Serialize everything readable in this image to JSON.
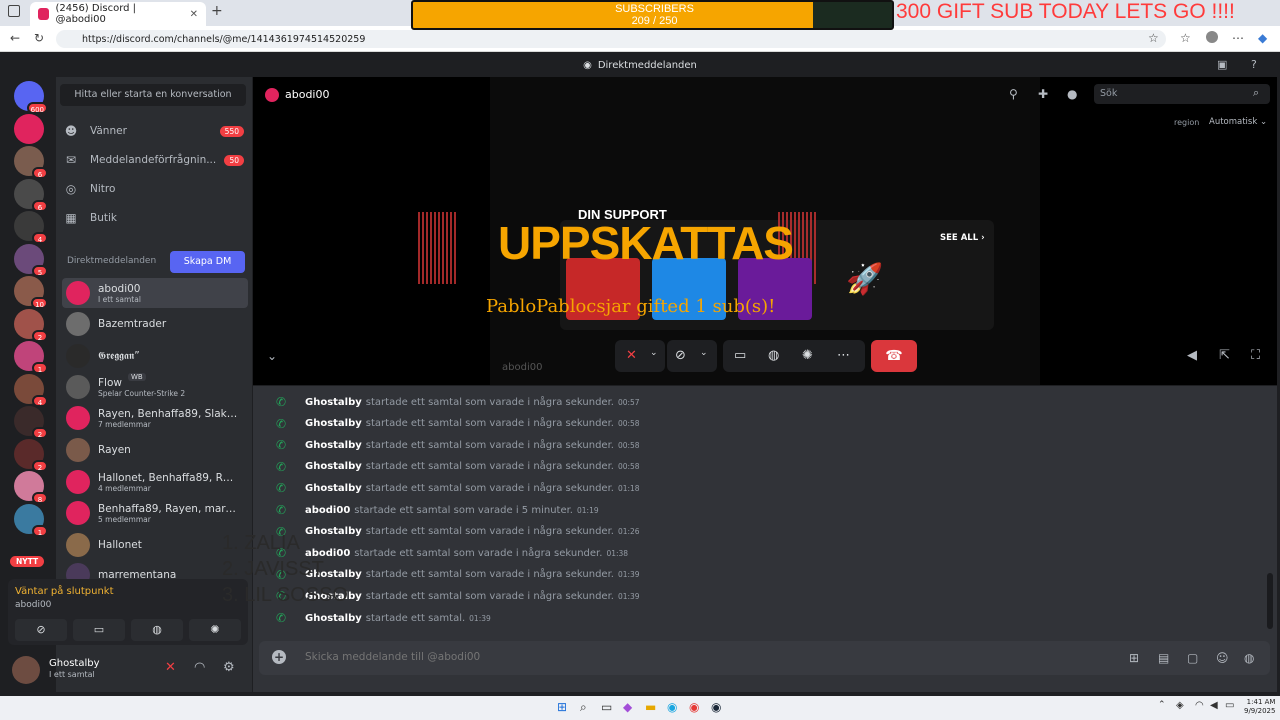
{
  "browser": {
    "tab_title": "(2456) Discord | @abodi00",
    "tab_close": "✕",
    "new_tab": "+",
    "url": "https://discord.com/channels/@me/1414361974514520259"
  },
  "overlay": {
    "subs_label": "SUBSCRIBERS",
    "subs_count": "209 / 250",
    "subs_progress": 0.836,
    "gift_banner": "300  GIFT SUB TODAY LETS GO !!!!",
    "din_support": "DIN SUPPORT",
    "uppskattas": "UPPSKATTAS",
    "gifted_line": "PabloPablocsjar gifted 1 sub(s)!",
    "top_list": [
      "1. ZALIA",
      "2. JAVISST",
      "3. LIL SOSSO"
    ]
  },
  "discord": {
    "window_title": "Direktmeddelanden",
    "find_conversation": "Hitta eller starta en konversation",
    "nav": [
      {
        "icon": "friends-icon",
        "label": "Vänner",
        "badge": "550"
      },
      {
        "icon": "envelope-icon",
        "label": "Meddelandeförfrågnin...",
        "badge": "50"
      },
      {
        "icon": "nitro-icon",
        "label": "Nitro",
        "badge": ""
      },
      {
        "icon": "shop-icon",
        "label": "Butik",
        "badge": ""
      }
    ],
    "dm_header": "Direktmeddelanden",
    "create_dm": "Skapa DM",
    "dms": [
      {
        "name": "abodi00",
        "sub": "I ett samtal",
        "active": true
      },
      {
        "name": "Bazemtrader",
        "sub": ""
      },
      {
        "name": "𝕲𝖗𝖊𝖌𝖌𝖆𝖓”",
        "sub": ""
      },
      {
        "name": "Flow",
        "tag": "WB",
        "sub": "Spelar Counter-Strike 2"
      },
      {
        "name": "Rayen, Benhaffa89, Slakta...",
        "sub": "7 medlemmar"
      },
      {
        "name": "Rayen",
        "sub": ""
      },
      {
        "name": "Hallonet, Benhaffa89, Ray...",
        "sub": "4 medlemmar"
      },
      {
        "name": "Benhaffa89, Rayen, marre...",
        "sub": "5 medlemmar"
      },
      {
        "name": "Hallonet",
        "sub": ""
      },
      {
        "name": "marrementana",
        "sub": ""
      }
    ],
    "server_badges": [
      "600",
      "",
      "6",
      "6",
      "4",
      "5",
      "10",
      "2",
      "1",
      "4",
      "2",
      "2",
      "8",
      "1"
    ],
    "new_badge": "NYTT",
    "voice_status": "Väntar på slutpunkt",
    "voice_user": "abodi00",
    "user": {
      "name": "Ghostalby",
      "status": "I ett samtal"
    }
  },
  "call": {
    "title": "abodi00",
    "search_placeholder": "Sök",
    "region_label": "region",
    "region_value": "Automatisk ⌄",
    "see_all": "SEE ALL  ›",
    "watermark": "abodi00"
  },
  "chat": {
    "messages": [
      {
        "who": "Ghostalby",
        "act": "startade ett samtal som varade i några sekunder.",
        "time": "00:57"
      },
      {
        "who": "Ghostalby",
        "act": "startade ett samtal som varade i några sekunder.",
        "time": "00:58"
      },
      {
        "who": "Ghostalby",
        "act": "startade ett samtal som varade i några sekunder.",
        "time": "00:58"
      },
      {
        "who": "Ghostalby",
        "act": "startade ett samtal som varade i några sekunder.",
        "time": "00:58"
      },
      {
        "who": "Ghostalby",
        "act": "startade ett samtal som varade i några sekunder.",
        "time": "01:18"
      },
      {
        "who": "abodi00",
        "act": "startade ett samtal som varade i 5 minuter.",
        "time": "01:19"
      },
      {
        "who": "Ghostalby",
        "act": "startade ett samtal som varade i några sekunder.",
        "time": "01:26"
      },
      {
        "who": "abodi00",
        "act": "startade ett samtal som varade i några sekunder.",
        "time": "01:38"
      },
      {
        "who": "Ghostalby",
        "act": "startade ett samtal som varade i några sekunder.",
        "time": "01:39"
      },
      {
        "who": "Ghostalby",
        "act": "startade ett samtal som varade i några sekunder.",
        "time": "01:39"
      },
      {
        "who": "Ghostalby",
        "act": "startade ett samtal.",
        "time": "01:39"
      }
    ],
    "input_placeholder": "Skicka meddelande till @abodi00"
  },
  "taskbar": {
    "time": "1:41 AM",
    "date": "9/9/2025"
  },
  "colors": {
    "brand": "#5865f2",
    "danger": "#da373c",
    "online": "#23a55a",
    "sub_fill": "#f6a500"
  }
}
